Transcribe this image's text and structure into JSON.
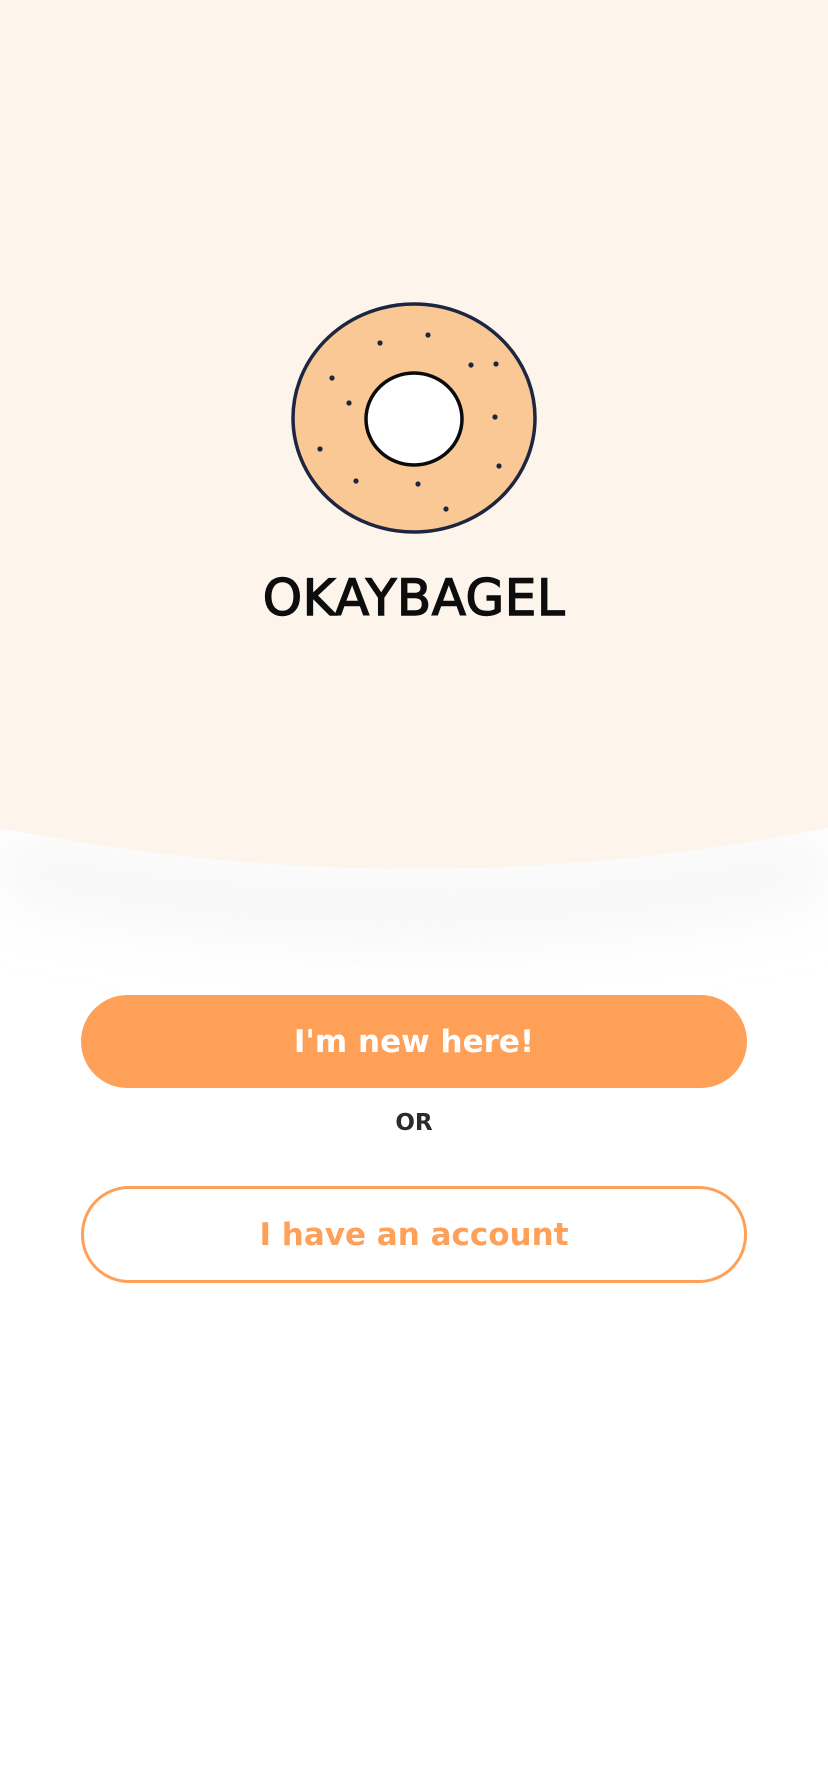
{
  "brand": {
    "name": "OKAYBAGEL",
    "logo_icon": "bagel-icon"
  },
  "actions": {
    "new_user_label": "I'm new here!",
    "separator": "OR",
    "existing_user_label": "I have an account"
  },
  "colors": {
    "hero_background": "#fdf4ec",
    "accent": "#ffa058",
    "bagel_fill": "#f9c894",
    "bagel_outline": "#1d2640",
    "page_background": "#ffffff"
  }
}
